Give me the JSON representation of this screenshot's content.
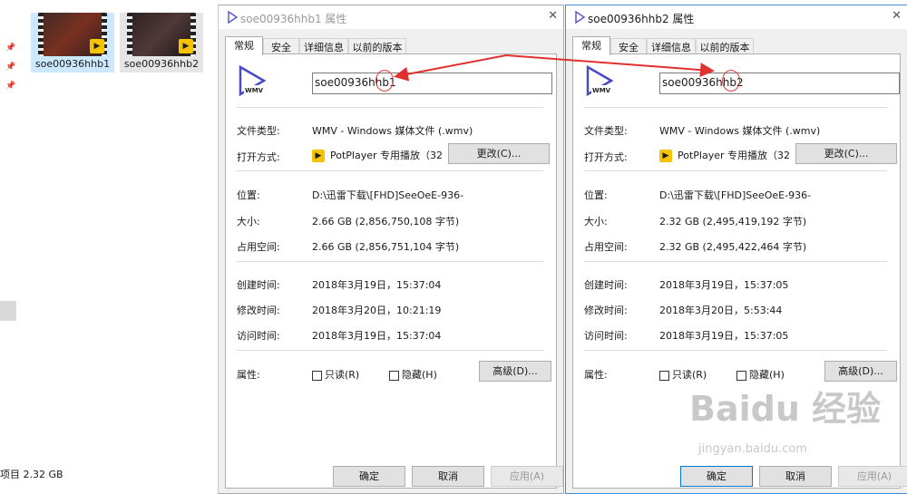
{
  "explorer": {
    "files": [
      {
        "name": "soe00936hhb1",
        "badge": "Player"
      },
      {
        "name": "soe00936hhb2",
        "badge": "Player"
      }
    ],
    "status": "项目  2.32 GB"
  },
  "dialogs": [
    {
      "title": "soe00936hhb1 属性",
      "tabs": [
        "常规",
        "安全",
        "详细信息",
        "以前的版本"
      ],
      "file_name": "soe00936hhb1",
      "file_type_label": "文件类型:",
      "file_type": "WMV - Windows 媒体文件 (.wmv)",
      "open_with_label": "打开方式:",
      "open_with": "PotPlayer 专用播放（32",
      "change_button": "更改(C)...",
      "location_label": "位置:",
      "location": "D:\\迅雷下载\\[FHD]SeeOeE-936-",
      "size_label": "大小:",
      "size": "2.66 GB (2,856,750,108 字节)",
      "disk_size_label": "占用空间:",
      "disk_size": "2.66 GB (2,856,751,104 字节)",
      "created_label": "创建时间:",
      "created": "2018年3月19日，15:37:04",
      "modified_label": "修改时间:",
      "modified": "2018年3月20日，10:21:19",
      "accessed_label": "访问时间:",
      "accessed": "2018年3月19日，15:37:04",
      "attributes_label": "属性:",
      "readonly_label": "只读(R)",
      "hidden_label": "隐藏(H)",
      "advanced_button": "高级(D)...",
      "ok_button": "确定",
      "cancel_button": "取消",
      "apply_button": "应用(A)"
    },
    {
      "title": "soe00936hhb2 属性",
      "tabs": [
        "常规",
        "安全",
        "详细信息",
        "以前的版本"
      ],
      "file_name": "soe00936hhb2",
      "file_type_label": "文件类型:",
      "file_type": "WMV - Windows 媒体文件 (.wmv)",
      "open_with_label": "打开方式:",
      "open_with": "PotPlayer 专用播放（32",
      "change_button": "更改(C)...",
      "location_label": "位置:",
      "location": "D:\\迅雷下载\\[FHD]SeeOeE-936-",
      "size_label": "大小:",
      "size": "2.32 GB (2,495,419,192 字节)",
      "disk_size_label": "占用空间:",
      "disk_size": "2.32 GB (2,495,422,464 字节)",
      "created_label": "创建时间:",
      "created": "2018年3月19日，15:37:05",
      "modified_label": "修改时间:",
      "modified": "2018年3月20日，5:53:44",
      "accessed_label": "访问时间:",
      "accessed": "2018年3月19日，15:37:05",
      "attributes_label": "属性:",
      "readonly_label": "只读(R)",
      "hidden_label": "隐藏(H)",
      "advanced_button": "高级(D)...",
      "ok_button": "确定",
      "cancel_button": "取消",
      "apply_button": "应用(A)"
    }
  ],
  "icon_label": "WMV",
  "watermark": {
    "brand": "Baidu 经验",
    "url": "jingyan.baidu.com"
  },
  "colors": {
    "accent": "#0078d7",
    "arrow": "#e03030",
    "selection": "#cce8ff",
    "potplayer": "#f6c300"
  }
}
